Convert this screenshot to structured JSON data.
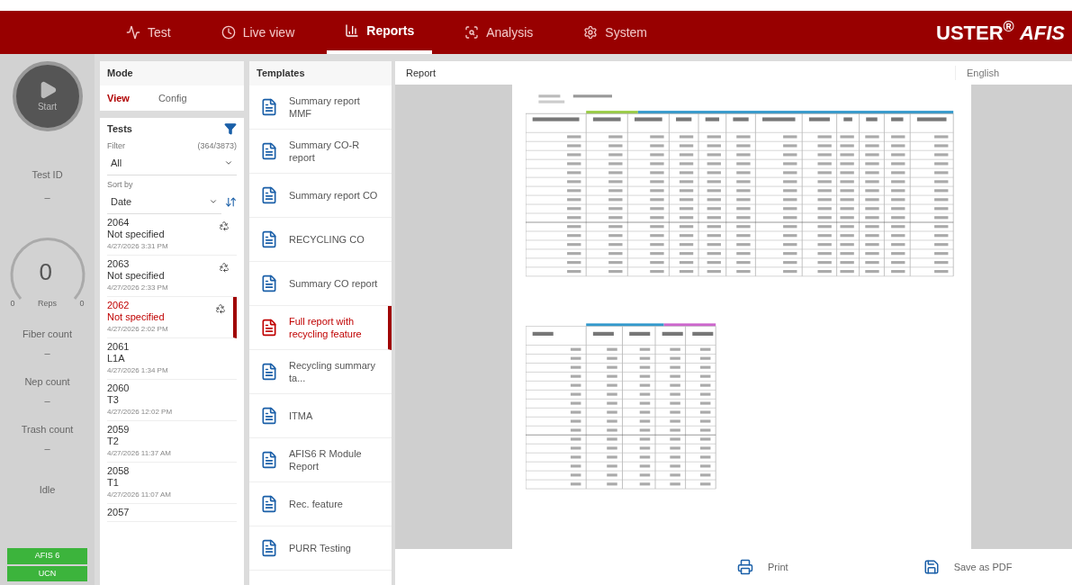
{
  "nav": {
    "tabs": [
      {
        "label": "Test",
        "kind": "test",
        "selected": false
      },
      {
        "label": "Live view",
        "kind": "live",
        "selected": false
      },
      {
        "label": "Reports",
        "kind": "reports",
        "selected": true
      },
      {
        "label": "Analysis",
        "kind": "analysis",
        "selected": false
      },
      {
        "label": "System",
        "kind": "system",
        "selected": false
      }
    ],
    "logo": "USTER$^{®}$",
    "product": "AFIS"
  },
  "status_panel": {
    "start": "Start",
    "test_id_label": "Test ID",
    "test_id_value": "–",
    "reps": {
      "value": "0",
      "min": "0",
      "label": "Reps",
      "max": "0"
    },
    "counts": [
      {
        "label": "Fiber count",
        "value": "–"
      },
      {
        "label": "Nep count",
        "value": "–"
      },
      {
        "label": "Trash count",
        "value": "–"
      }
    ],
    "state": "Idle",
    "modules": [
      "AFIS 6",
      "UCN"
    ]
  },
  "mode": {
    "title": "Mode",
    "options": [
      {
        "label": "View",
        "selected": true
      },
      {
        "label": "Config",
        "selected": false
      }
    ]
  },
  "tests": {
    "title": "Tests",
    "filter_label": "Filter",
    "filter_count": "(364/3873)",
    "filter_value": "All",
    "sort_label": "Sort by",
    "sort_value": "Date",
    "items": [
      {
        "id": "2064",
        "name": "Not specified",
        "date": "4/27/2026 3:31 PM",
        "recycling": true,
        "selected": false
      },
      {
        "id": "2063",
        "name": "Not specified",
        "date": "4/27/2026 2:33 PM",
        "recycling": true,
        "selected": false
      },
      {
        "id": "2062",
        "name": "Not specified",
        "date": "4/27/2026 2:02 PM",
        "recycling": true,
        "selected": true
      },
      {
        "id": "2061",
        "name": "L1A",
        "date": "4/27/2026 1:34 PM",
        "recycling": false,
        "selected": false
      },
      {
        "id": "2060",
        "name": "T3",
        "date": "4/27/2026 12:02 PM",
        "recycling": false,
        "selected": false
      },
      {
        "id": "2059",
        "name": "T2",
        "date": "4/27/2026 11:37 AM",
        "recycling": false,
        "selected": false
      },
      {
        "id": "2058",
        "name": "T1",
        "date": "4/27/2026 11:07 AM",
        "recycling": false,
        "selected": false
      },
      {
        "id": "2057",
        "selected": false,
        "recycling": false
      }
    ]
  },
  "templates": {
    "title": "Templates",
    "items": [
      {
        "label": "Summary report MMF",
        "selected": false
      },
      {
        "label": "Summary CO-R report",
        "selected": false
      },
      {
        "label": "Summary report CO",
        "selected": false
      },
      {
        "label": "RECYCLING CO",
        "selected": false
      },
      {
        "label": "Summary CO report",
        "selected": false
      },
      {
        "label": "Full report with recycling feature",
        "selected": true
      },
      {
        "label": "Recycling summary ta...",
        "selected": false
      },
      {
        "label": "ITMA",
        "selected": false
      },
      {
        "label": "AFIS6 R Module Report",
        "selected": false
      },
      {
        "label": "Rec. feature",
        "selected": false
      },
      {
        "label": "PURR Testing",
        "selected": false
      }
    ]
  },
  "report": {
    "title": "Report",
    "language": "English",
    "actions": [
      {
        "label": "Print",
        "kind": "print"
      },
      {
        "label": "Save as PDF",
        "kind": "pdf"
      }
    ]
  }
}
